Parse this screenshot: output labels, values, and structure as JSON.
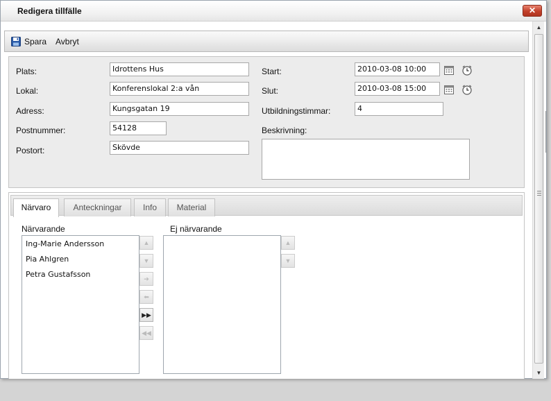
{
  "window": {
    "title": "Redigera tillfälle",
    "close_glyph": "✕"
  },
  "toolbar": {
    "save_label": "Spara",
    "cancel_label": "Avbryt",
    "save_icon": "floppy-disk-icon"
  },
  "form": {
    "location_label": "Plats:",
    "location_value": "Idrottens Hus",
    "room_label": "Lokal:",
    "room_value": "Konferenslokal 2:a vån",
    "address_label": "Adress:",
    "address_value": "Kungsgatan 19",
    "zip_label": "Postnummer:",
    "zip_value": "54128",
    "city_label": "Postort:",
    "city_value": "Skövde",
    "start_label": "Start:",
    "start_value": "2010-03-08 10:00",
    "end_label": "Slut:",
    "end_value": "2010-03-08 15:00",
    "hours_label": "Utbildningstimmar:",
    "hours_value": "4",
    "description_label": "Beskrivning:",
    "description_value": "",
    "icons": [
      "calendar-icon",
      "clock-icon"
    ]
  },
  "tabs": [
    {
      "label": "Närvaro",
      "active": true
    },
    {
      "label": "Anteckningar",
      "active": false
    },
    {
      "label": "Info",
      "active": false
    },
    {
      "label": "Material",
      "active": false
    }
  ],
  "attendance": {
    "present_label": "Närvarande",
    "present": [
      "Ing-Marie Andersson",
      "Pia Ahlgren",
      "Petra Gustafsson"
    ],
    "absent_label": "Ej närvarande",
    "absent": []
  },
  "move_buttons": {
    "up": "▲",
    "down": "▼",
    "right": "➔",
    "left": "⬅",
    "all_right": "▶▶",
    "all_left": "◀◀"
  },
  "scrollbar": {
    "up": "▲",
    "down": "▼"
  },
  "colors": {
    "close_button": "#c2402a",
    "panel_bg": "#ececec",
    "save_icon": "#2a5ba8"
  }
}
